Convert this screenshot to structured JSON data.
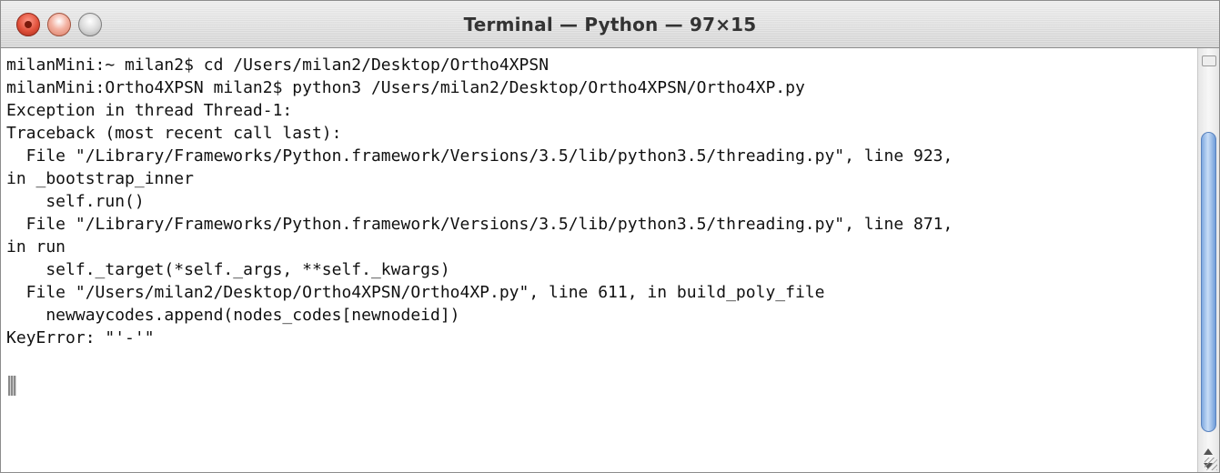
{
  "window": {
    "title": "Terminal — Python — 97×15"
  },
  "terminal": {
    "lines": [
      "milanMini:~ milan2$ cd /Users/milan2/Desktop/Ortho4XPSN",
      "milanMini:Ortho4XPSN milan2$ python3 /Users/milan2/Desktop/Ortho4XPSN/Ortho4XP.py",
      "Exception in thread Thread-1:",
      "Traceback (most recent call last):",
      "  File \"/Library/Frameworks/Python.framework/Versions/3.5/lib/python3.5/threading.py\", line 923,",
      "in _bootstrap_inner",
      "    self.run()",
      "  File \"/Library/Frameworks/Python.framework/Versions/3.5/lib/python3.5/threading.py\", line 871,",
      "in run",
      "    self._target(*self._args, **self._kwargs)",
      "  File \"/Users/milan2/Desktop/Ortho4XPSN/Ortho4XP.py\", line 611, in build_poly_file",
      "    newwaycodes.append(nodes_codes[newnodeid])",
      "KeyError: \"'-'\"",
      ""
    ]
  },
  "icons": {
    "close": "close-icon",
    "minimize": "minimize-icon",
    "zoom": "zoom-icon",
    "cursor": "cursor-block"
  },
  "colors": {
    "close": "#e0503a",
    "minimize": "#f3b2a2",
    "zoom": "#d8d8d8",
    "scroll_thumb": "#7fa9e0",
    "text": "#111111"
  }
}
